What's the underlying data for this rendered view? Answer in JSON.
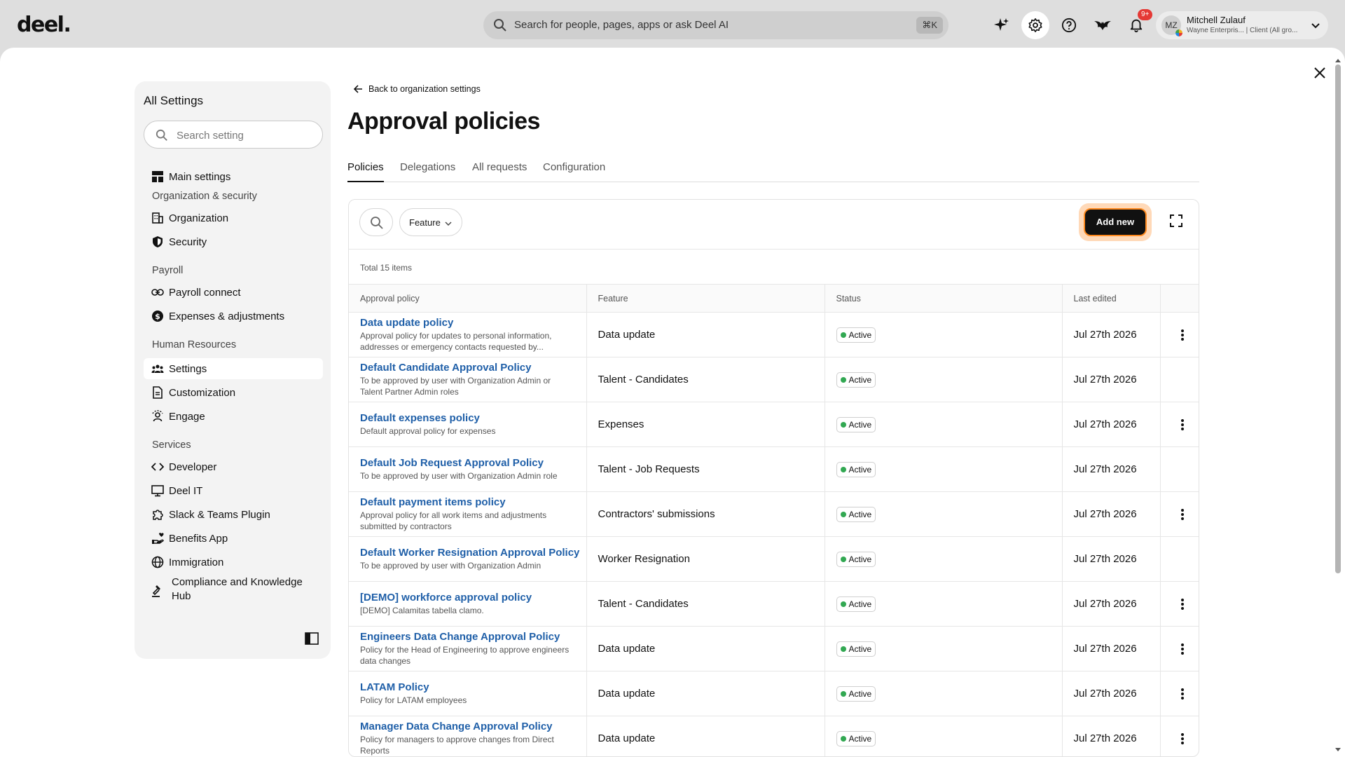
{
  "app": {
    "logo": "deel.",
    "search_placeholder": "Search for people, pages, apps or ask Deel AI",
    "search_shortcut": "⌘K",
    "notification_count": "9+",
    "user": {
      "initials": "MZ",
      "name": "Mitchell Zulauf",
      "org": "Wayne Enterpris... | Client (All gro..."
    }
  },
  "sidebar": {
    "title": "All Settings",
    "search_placeholder": "Search setting",
    "main_settings": "Main settings",
    "sections": {
      "org_security": "Organization & security",
      "payroll": "Payroll",
      "hr": "Human Resources",
      "services": "Services"
    },
    "items": {
      "organization": "Organization",
      "security": "Security",
      "payroll_connect": "Payroll connect",
      "expenses": "Expenses & adjustments",
      "settings": "Settings",
      "customization": "Customization",
      "engage": "Engage",
      "developer": "Developer",
      "deel_it": "Deel IT",
      "slack_teams": "Slack & Teams Plugin",
      "benefits": "Benefits App",
      "immigration": "Immigration",
      "compliance": "Compliance and Knowledge Hub"
    }
  },
  "content": {
    "back_link": "Back to organization settings",
    "title": "Approval policies",
    "tabs": [
      "Policies",
      "Delegations",
      "All requests",
      "Configuration"
    ],
    "filter_feature": "Feature",
    "add_new": "Add new",
    "total": "Total 15 items",
    "columns": [
      "Approval policy",
      "Feature",
      "Status",
      "Last edited"
    ],
    "rows": [
      {
        "name": "Data update policy",
        "desc": "Approval policy for updates to personal information, addresses or emergency contacts requested by...",
        "feature": "Data update",
        "status": "Active",
        "edited": "Jul 27th 2026",
        "menu": true
      },
      {
        "name": "Default Candidate Approval Policy",
        "desc": "To be approved by user with Organization Admin or Talent Partner Admin roles",
        "feature": "Talent - Candidates",
        "status": "Active",
        "edited": "Jul 27th 2026",
        "menu": false
      },
      {
        "name": "Default expenses policy",
        "desc": "Default approval policy for expenses",
        "feature": "Expenses",
        "status": "Active",
        "edited": "Jul 27th 2026",
        "menu": true
      },
      {
        "name": "Default Job Request Approval Policy",
        "desc": "To be approved by user with Organization Admin role",
        "feature": "Talent - Job Requests",
        "status": "Active",
        "edited": "Jul 27th 2026",
        "menu": false
      },
      {
        "name": "Default payment items policy",
        "desc": "Approval policy for all work items and adjustments submitted by contractors",
        "feature": "Contractors' submissions",
        "status": "Active",
        "edited": "Jul 27th 2026",
        "menu": true
      },
      {
        "name": "Default Worker Resignation Approval Policy",
        "desc": "To be approved by user with Organization Admin",
        "feature": "Worker Resignation",
        "status": "Active",
        "edited": "Jul 27th 2026",
        "menu": false
      },
      {
        "name": "[DEMO] workforce approval policy",
        "desc": "[DEMO] Calamitas tabella clamo.",
        "feature": "Talent - Candidates",
        "status": "Active",
        "edited": "Jul 27th 2026",
        "menu": true
      },
      {
        "name": "Engineers Data Change Approval Policy",
        "desc": "Policy for the Head of Engineering to approve engineers data changes",
        "feature": "Data update",
        "status": "Active",
        "edited": "Jul 27th 2026",
        "menu": true
      },
      {
        "name": "LATAM Policy",
        "desc": "Policy for LATAM employees",
        "feature": "Data update",
        "status": "Active",
        "edited": "Jul 27th 2026",
        "menu": true
      },
      {
        "name": "Manager Data Change Approval Policy",
        "desc": "Policy for managers to approve changes from Direct Reports",
        "feature": "Data update",
        "status": "Active",
        "edited": "Jul 27th 2026",
        "menu": true
      }
    ]
  },
  "colors": {
    "accent_link": "#1f5fa8",
    "status_active": "#32a852",
    "focus_ring": "#ff8a1f"
  }
}
